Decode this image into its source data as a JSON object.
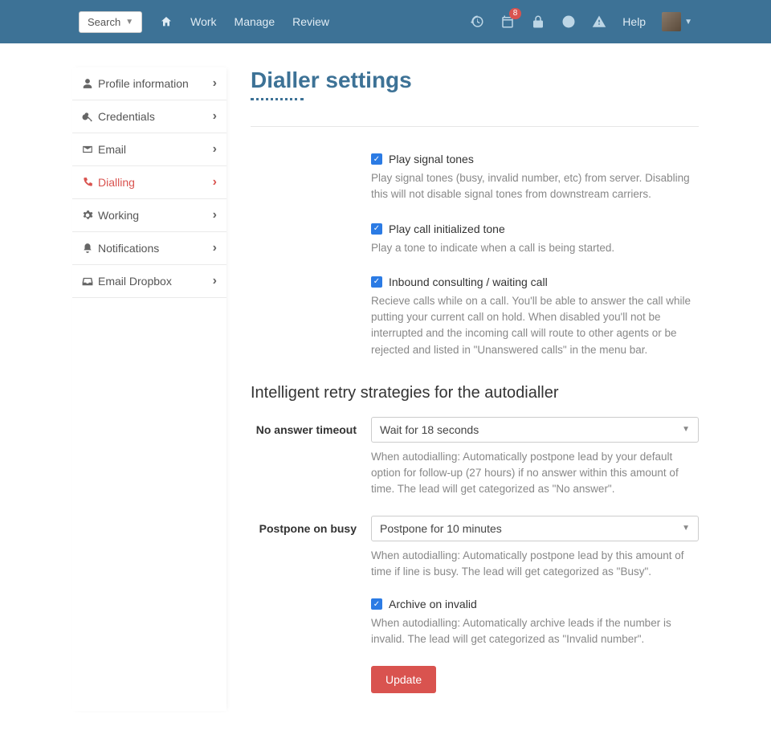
{
  "topbar": {
    "search_label": "Search",
    "nav": {
      "work": "Work",
      "manage": "Manage",
      "review": "Review"
    },
    "help": "Help",
    "notification_count": "8"
  },
  "sidebar": {
    "items": [
      {
        "label": "Profile information"
      },
      {
        "label": "Credentials"
      },
      {
        "label": "Email"
      },
      {
        "label": "Dialling"
      },
      {
        "label": "Working"
      },
      {
        "label": "Notifications"
      },
      {
        "label": "Email Dropbox"
      }
    ]
  },
  "page": {
    "title": "Dialler settings",
    "section_heading": "Intelligent retry strategies for the autodialler"
  },
  "fields": {
    "signal_tones": {
      "label": "Play signal tones",
      "help": "Play signal tones (busy, invalid number, etc) from server. Disabling this will not disable signal tones from downstream carriers."
    },
    "init_tone": {
      "label": "Play call initialized tone",
      "help": "Play a tone to indicate when a call is being started."
    },
    "inbound": {
      "label": "Inbound consulting / waiting call",
      "help": "Recieve calls while on a call. You'll be able to answer the call while putting your current call on hold. When disabled you'll not be interrupted and the incoming call will route to other agents or be rejected and listed in \"Unanswered calls\" in the menu bar."
    },
    "no_answer": {
      "label": "No answer timeout",
      "value": "Wait for 18 seconds",
      "help": "When autodialling: Automatically postpone lead by your default option for follow-up (27 hours) if no answer within this amount of time. The lead will get categorized as \"No answer\"."
    },
    "postpone_busy": {
      "label": "Postpone on busy",
      "value": "Postpone for 10 minutes",
      "help": "When autodialling: Automatically postpone lead by this amount of time if line is busy. The lead will get categorized as \"Busy\"."
    },
    "archive_invalid": {
      "label": "Archive on invalid",
      "help": "When autodialling: Automatically archive leads if the number is invalid. The lead will get categorized as \"Invalid number\"."
    },
    "update_btn": "Update"
  }
}
